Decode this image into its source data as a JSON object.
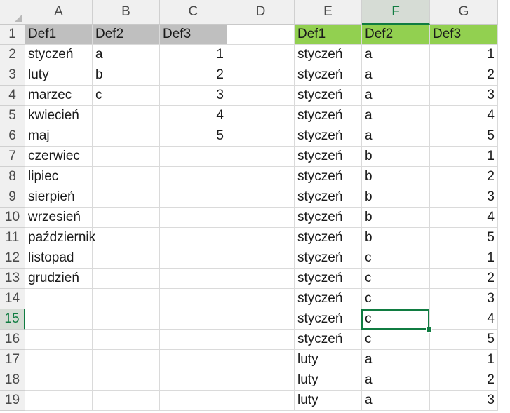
{
  "columns": [
    "A",
    "B",
    "C",
    "D",
    "E",
    "F",
    "G"
  ],
  "active_column": "F",
  "active_row": "15",
  "rows": [
    {
      "num": "1",
      "cells": [
        "Def1",
        "Def2",
        "Def3",
        "",
        "Def1",
        "Def2",
        "Def3"
      ]
    },
    {
      "num": "2",
      "cells": [
        "styczeń",
        "a",
        "1",
        "",
        "styczeń",
        "a",
        "1"
      ]
    },
    {
      "num": "3",
      "cells": [
        "luty",
        "b",
        "2",
        "",
        "styczeń",
        "a",
        "2"
      ]
    },
    {
      "num": "4",
      "cells": [
        "marzec",
        "c",
        "3",
        "",
        "styczeń",
        "a",
        "3"
      ]
    },
    {
      "num": "5",
      "cells": [
        "kwiecień",
        "",
        "4",
        "",
        "styczeń",
        "a",
        "4"
      ]
    },
    {
      "num": "6",
      "cells": [
        "maj",
        "",
        "5",
        "",
        "styczeń",
        "a",
        "5"
      ]
    },
    {
      "num": "7",
      "cells": [
        "czerwiec",
        "",
        "",
        "",
        "styczeń",
        "b",
        "1"
      ]
    },
    {
      "num": "8",
      "cells": [
        "lipiec",
        "",
        "",
        "",
        "styczeń",
        "b",
        "2"
      ]
    },
    {
      "num": "9",
      "cells": [
        "sierpień",
        "",
        "",
        "",
        "styczeń",
        "b",
        "3"
      ]
    },
    {
      "num": "10",
      "cells": [
        "wrzesień",
        "",
        "",
        "",
        "styczeń",
        "b",
        "4"
      ]
    },
    {
      "num": "11",
      "cells": [
        "październik",
        "",
        "",
        "",
        "styczeń",
        "b",
        "5"
      ]
    },
    {
      "num": "12",
      "cells": [
        "listopad",
        "",
        "",
        "",
        "styczeń",
        "c",
        "1"
      ]
    },
    {
      "num": "13",
      "cells": [
        "grudzień",
        "",
        "",
        "",
        "styczeń",
        "c",
        "2"
      ]
    },
    {
      "num": "14",
      "cells": [
        "",
        "",
        "",
        "",
        "styczeń",
        "c",
        "3"
      ]
    },
    {
      "num": "15",
      "cells": [
        "",
        "",
        "",
        "",
        "styczeń",
        "c",
        "4"
      ]
    },
    {
      "num": "16",
      "cells": [
        "",
        "",
        "",
        "",
        "styczeń",
        "c",
        "5"
      ]
    },
    {
      "num": "17",
      "cells": [
        "",
        "",
        "",
        "",
        "luty",
        "a",
        "1"
      ]
    },
    {
      "num": "18",
      "cells": [
        "",
        "",
        "",
        "",
        "luty",
        "a",
        "2"
      ]
    },
    {
      "num": "19",
      "cells": [
        "",
        "",
        "",
        "",
        "luty",
        "a",
        "3"
      ]
    }
  ],
  "colors": {
    "header_gray": "#bfbfbf",
    "header_green": "#92d050",
    "selection_green": "#107c41"
  },
  "icons": {
    "select_all": "select-all-triangle-icon"
  }
}
